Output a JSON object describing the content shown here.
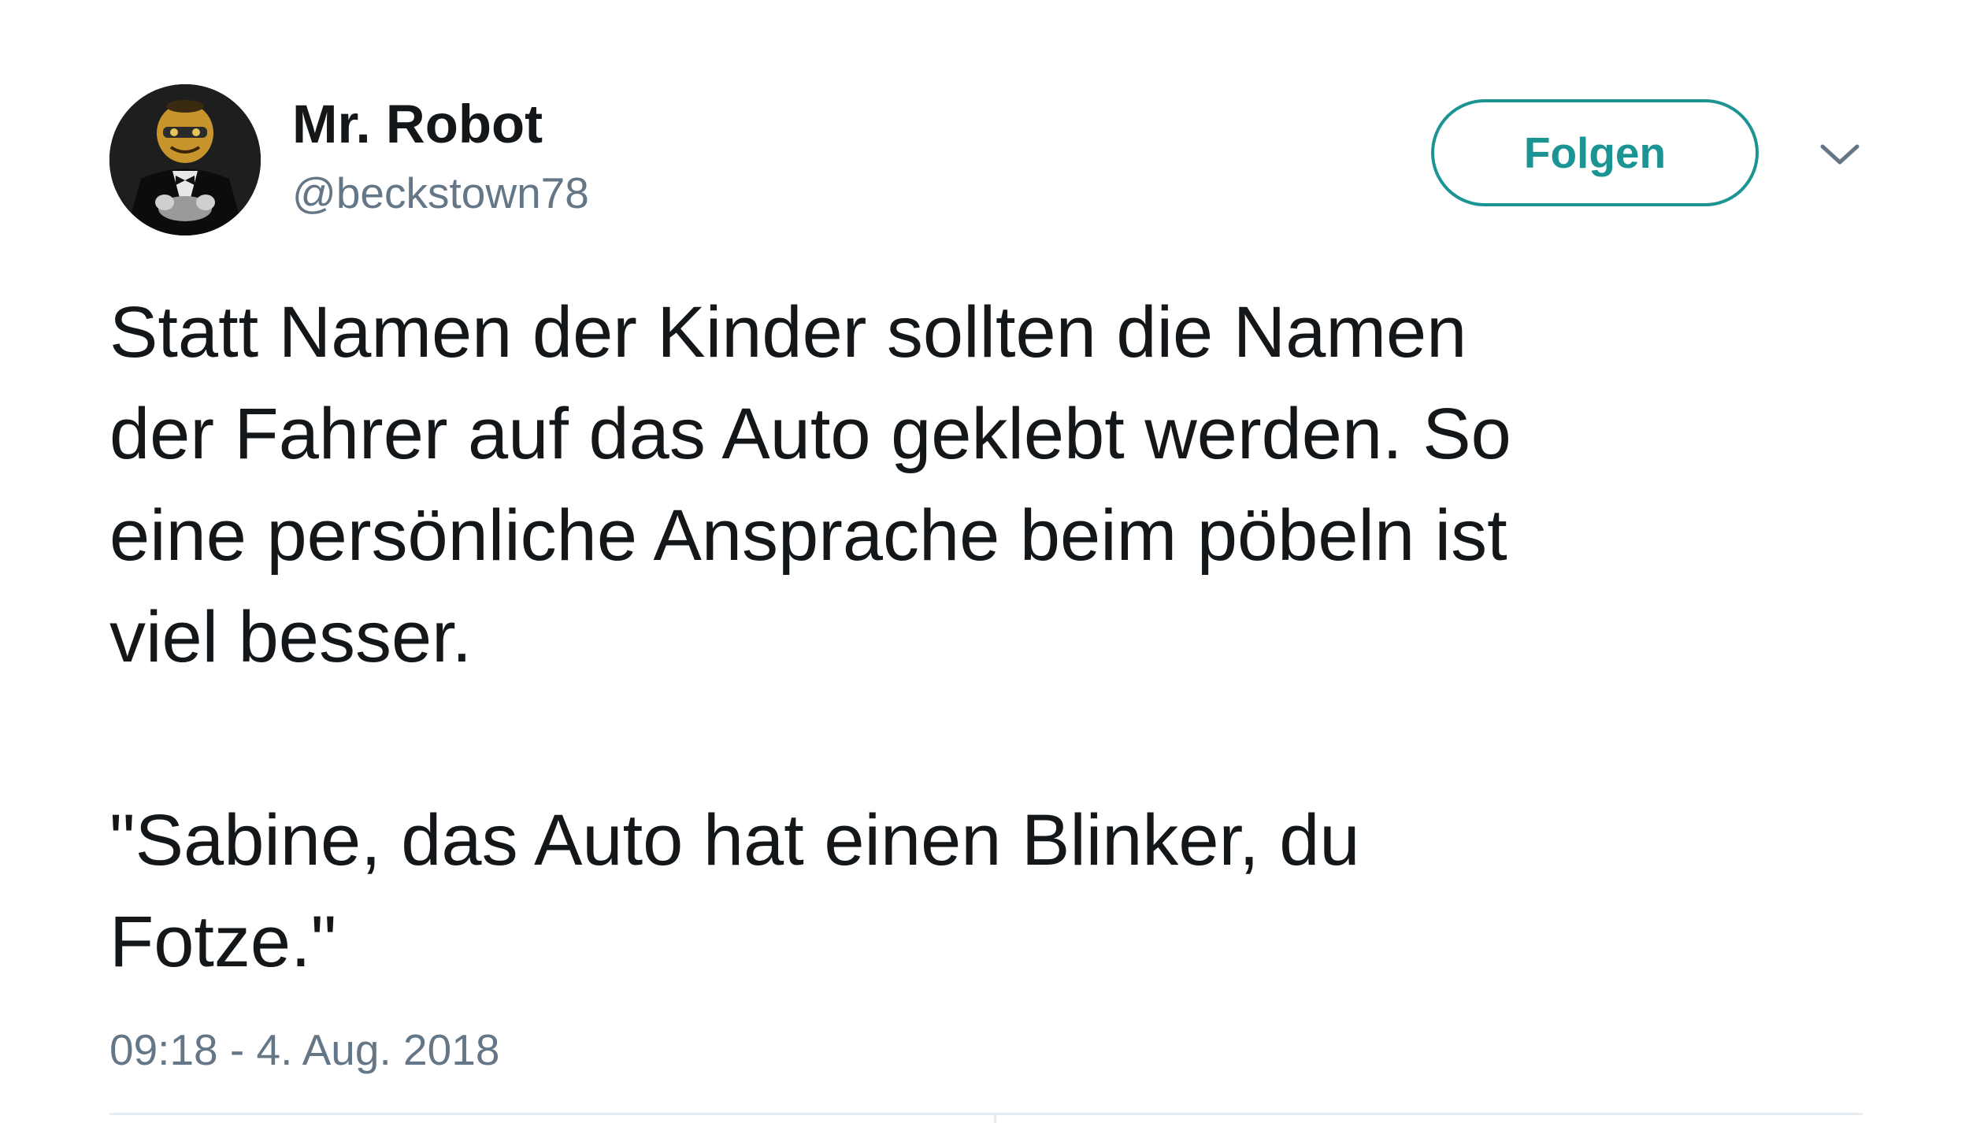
{
  "tweet": {
    "display_name": "Mr. Robot",
    "handle": "@beckstown78",
    "follow_label": "Folgen",
    "paragraphs": [
      "Statt Namen der Kinder sollten die Namen\nder Fahrer auf das Auto geklebt werden. So\neine persönliche Ansprache beim pöbeln ist\nviel besser.",
      "\"Sabine, das Auto hat einen Blinker, du\nFotze.\""
    ],
    "timestamp": "09:18 - 4. Aug. 2018",
    "more_icon": "chevron-down-icon",
    "accent_color": "#1b9493"
  }
}
